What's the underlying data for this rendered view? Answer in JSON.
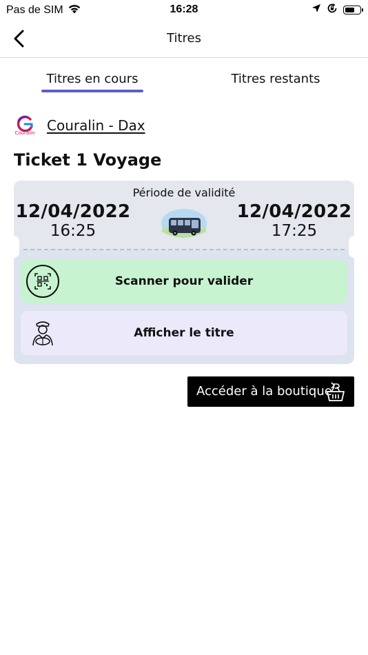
{
  "status_bar": {
    "carrier": "Pas de SIM",
    "time": "16:28",
    "battery_level_percent": 70
  },
  "nav": {
    "title": "Titres"
  },
  "tabs": [
    {
      "label": "Titres en cours",
      "active": true
    },
    {
      "label": "Titres restants",
      "active": false
    }
  ],
  "operator": {
    "name": "Couralin - Dax",
    "logo_text": "Couralin"
  },
  "ticket": {
    "title": "Ticket 1 Voyage",
    "validity_label": "Période de validité",
    "start_date": "12/04/2022",
    "start_time": "16:25",
    "end_date": "12/04/2022",
    "end_time": "17:25"
  },
  "actions": {
    "scan_label": "Scanner pour valider",
    "show_label": "Afficher le titre"
  },
  "shop": {
    "label": "Accéder à la boutique"
  },
  "colors": {
    "accent": "#5b5fc7",
    "scan_bg": "#c8f3d0",
    "show_bg": "#ece9fb",
    "card_bg": "#dde3ef"
  },
  "icons": {
    "back": "chevron-left-icon",
    "wifi": "wifi-icon",
    "location": "location-arrow-icon",
    "rotation_lock": "rotation-lock-icon",
    "battery": "battery-icon",
    "scan": "qr-code-icon",
    "show": "driver-icon",
    "shop": "shopping-basket-icon",
    "bus": "bus-icon"
  }
}
